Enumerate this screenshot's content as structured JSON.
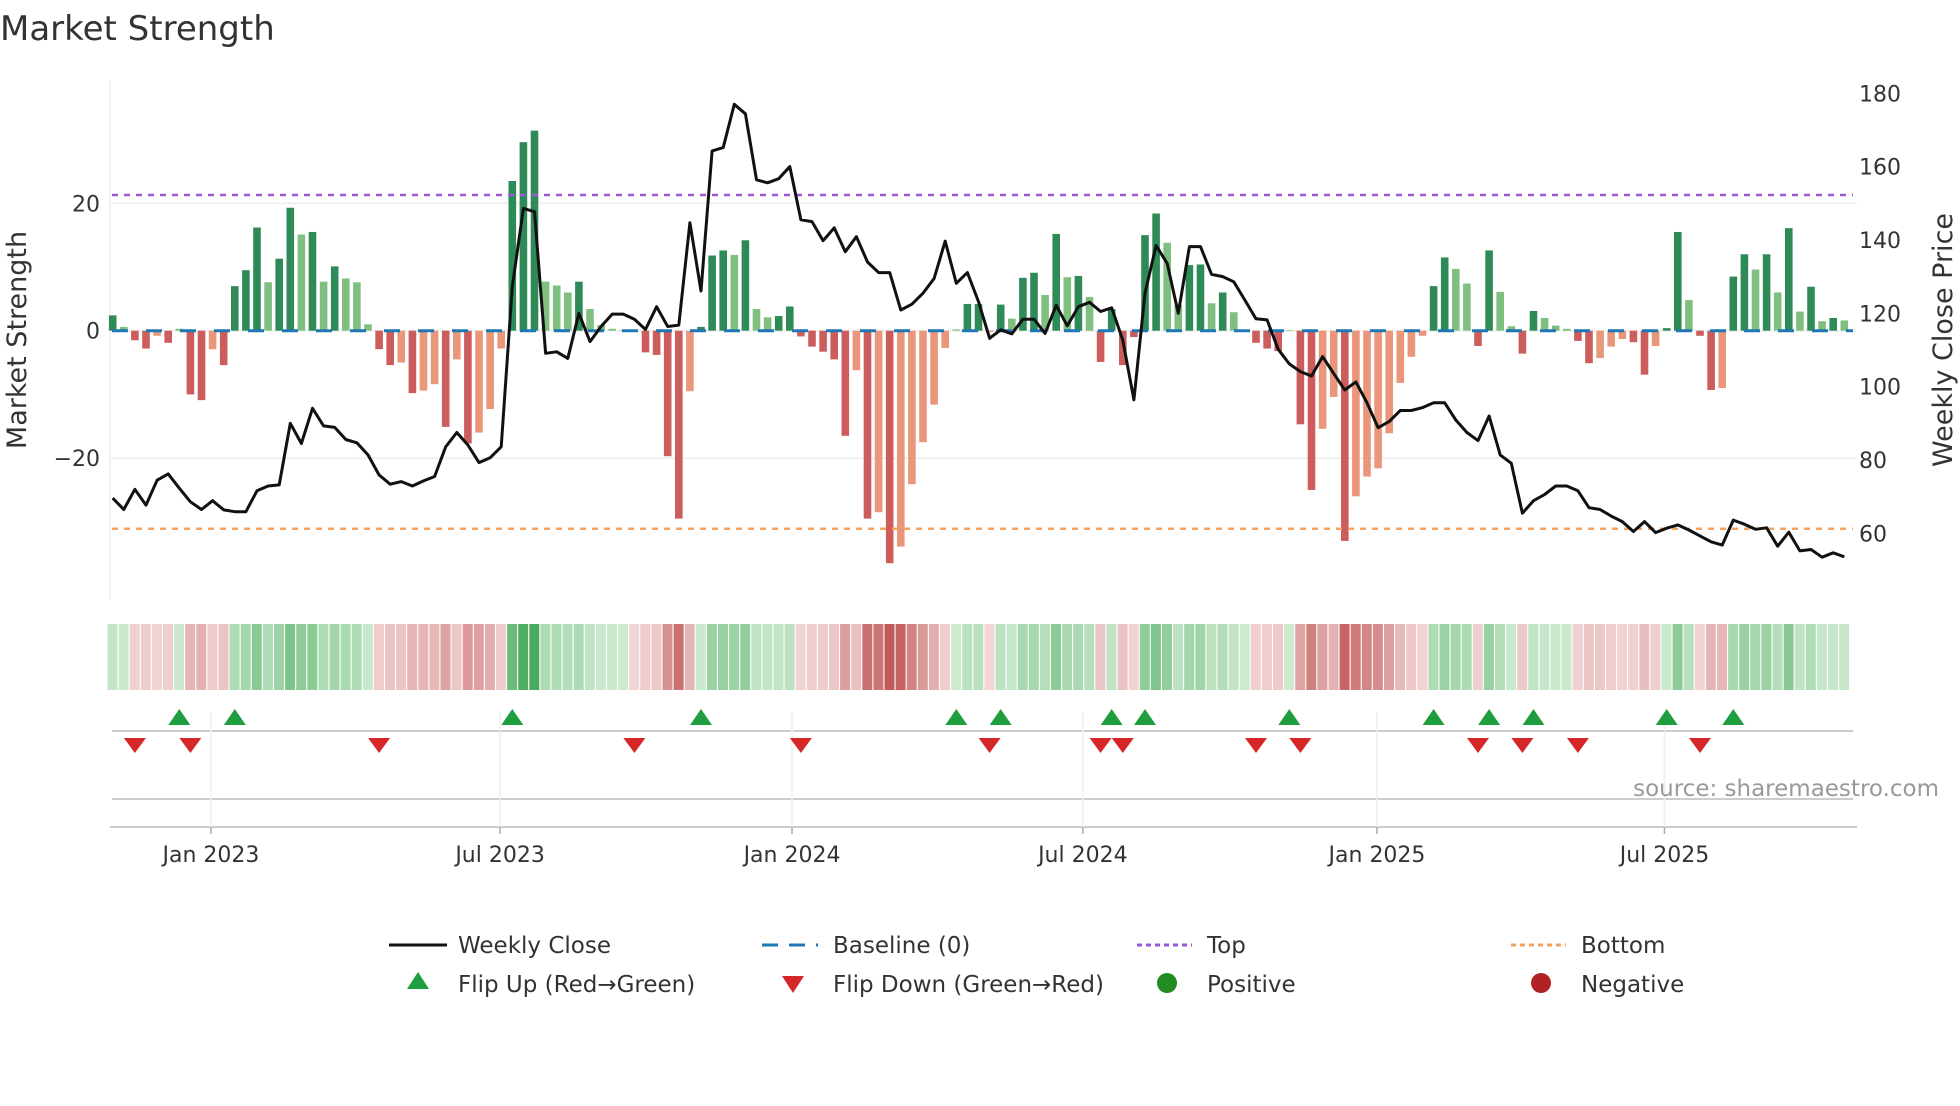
{
  "chart_data": {
    "type": "bar",
    "title": "Market Strength",
    "ylabel_left": "Market Strength",
    "ylabel_right": "Weekly Close Price",
    "source": "source: sharemaestro.com",
    "ylim_left": [
      -42.3,
      39.4
    ],
    "ylim_right": [
      41.8,
      183.6
    ],
    "left_ticks": [
      {
        "value": 20,
        "label": "20"
      },
      {
        "value": 0,
        "label": "0"
      },
      {
        "value": -20,
        "label": "−20"
      }
    ],
    "right_ticks": [
      {
        "value": 60,
        "label": "60"
      },
      {
        "value": 80,
        "label": "80"
      },
      {
        "value": 100,
        "label": "100"
      },
      {
        "value": 120,
        "label": "120"
      },
      {
        "value": 140,
        "label": "140"
      },
      {
        "value": 160,
        "label": "160"
      },
      {
        "value": 180,
        "label": "180"
      }
    ],
    "x_ticks": [
      {
        "label": "Jan 2023",
        "week": 8.85
      },
      {
        "label": "Jul 2023",
        "week": 34.9
      },
      {
        "label": "Jan 2024",
        "week": 61.2
      },
      {
        "label": "Jul 2024",
        "week": 87.4
      },
      {
        "label": "Jan 2025",
        "week": 113.9
      },
      {
        "label": "Jul 2025",
        "week": 139.8
      }
    ],
    "top_level": 21.3,
    "bottom_level": -31.1,
    "baseline": 0,
    "strength": [
      2.4,
      0.6,
      -1.5,
      -2.8,
      -0.8,
      -1.9,
      0.3,
      -10,
      -10.9,
      -2.9,
      -5.4,
      7.0,
      9.5,
      16.2,
      7.6,
      11.3,
      19.3,
      15.1,
      15.5,
      7.7,
      10.1,
      8.2,
      7.6,
      1.0,
      -2.9,
      -5.4,
      -5.0,
      -9.8,
      -9.4,
      -8.4,
      -15.1,
      -4.5,
      -17.7,
      -16,
      -12.3,
      -2.8,
      23.5,
      29.6,
      31.4,
      7.7,
      7.1,
      6.0,
      7.7,
      3.4,
      0.9,
      0.3,
      0.1,
      -0.2,
      -3.4,
      -3.8,
      -19.7,
      -29.5,
      -9.5,
      0.6,
      11.8,
      12.6,
      11.9,
      14.2,
      3.4,
      2.1,
      2.3,
      3.8,
      -0.9,
      -2.5,
      -3.3,
      -4.5,
      -16.5,
      -6.2,
      -29.5,
      -28.5,
      -36.5,
      -33.9,
      -24.1,
      -17.5,
      -11.6,
      -2.7,
      0.2,
      4.2,
      4.2,
      -0.2,
      4.1,
      1.9,
      8.3,
      9.1,
      5.6,
      15.2,
      8.4,
      8.6,
      5.3,
      -4.9,
      3.4,
      -5.4,
      -1.0,
      15.0,
      18.4,
      13.8,
      4.0,
      10.3,
      10.4,
      4.3,
      6.0,
      2.9,
      0.1,
      -1.9,
      -2.8,
      -3.2,
      0.1,
      -14.7,
      -25,
      -15.4,
      -10.4,
      -33,
      -26,
      -22.9,
      -21.6,
      -16.1,
      -8.2,
      -4.1,
      -0.8,
      7.0,
      11.5,
      9.7,
      7.4,
      -2.4,
      12.6,
      6.1,
      0.7,
      -3.6,
      3.1,
      2.0,
      0.8,
      0.3,
      -1.6,
      -5.1,
      -4.3,
      -2.5,
      -1.3,
      -1.8,
      -6.9,
      -2.4,
      0.4,
      15.5,
      4.8,
      -0.8,
      -9.3,
      -9.0,
      8.5,
      12.0,
      9.6,
      12.0,
      6.0,
      16.1,
      3.0,
      6.9,
      1.5,
      2.0,
      1.6
    ],
    "shade": "DLDDLDLDDLDDDDLDDLDLDLLLDDLDLLDLDLLLDDDLLLDLLLLLDDDDLDDDLDLLDDDDDDDLDLDLLLLLLDDLDLDDLDLDLDDDDDDLLDDLDLLDDDLDDLLDLLLLLLLDDLLDDLLDDLLLDDLLLDDLDDLDDLDDLDLDLDLDL",
    "weekly_close": [
      69.6,
      66.5,
      72,
      67.7,
      74.5,
      76.2,
      72.3,
      68.6,
      66.5,
      68.9,
      66.4,
      65.9,
      65.9,
      71.6,
      72.9,
      73.2,
      90,
      84.5,
      94.1,
      89.3,
      88.9,
      85.6,
      84.7,
      81.4,
      75.9,
      73.4,
      74.1,
      72.9,
      74.3,
      75.5,
      83.6,
      87.5,
      84.1,
      79.3,
      80.6,
      83.6,
      127.3,
      148.6,
      147.7,
      109.1,
      109.5,
      107.7,
      120,
      112.3,
      116.4,
      119.8,
      119.8,
      118.4,
      115.6,
      121.8,
      116.4,
      116.8,
      144.7,
      126.1,
      164.3,
      165.2,
      177,
      174.4,
      156.4,
      155.6,
      156.7,
      160,
      145.5,
      145,
      139.8,
      143.3,
      136.8,
      140.9,
      134,
      131.1,
      131.1,
      120.9,
      122.5,
      125.5,
      129.5,
      139.7,
      128.2,
      131.1,
      123.2,
      113.2,
      115.5,
      114.4,
      118.4,
      118.4,
      114.5,
      122.2,
      116.6,
      121.8,
      123,
      120.5,
      121.5,
      112.7,
      96.4,
      125.5,
      138.5,
      133.6,
      120,
      138.2,
      138.2,
      130.6,
      130,
      128.6,
      123.6,
      118.5,
      118.2,
      110.2,
      106.2,
      104.1,
      102.9,
      108.2,
      103.6,
      99.1,
      101.3,
      95.6,
      88.8,
      90.5,
      93.5,
      93.5,
      94.3,
      95.6,
      95.6,
      90.9,
      87.5,
      85.3,
      92,
      81.4,
      79.1,
      65.5,
      68.9,
      70.6,
      72.9,
      72.9,
      71.6,
      67,
      66.5,
      64.7,
      63.2,
      60.5,
      63.2,
      60.2,
      61.4,
      62.3,
      60.9,
      59.3,
      57.7,
      56.8,
      63.6,
      62.5,
      61.1,
      61.5,
      56.5,
      60.3,
      55.2,
      55.6,
      53.5,
      54.7,
      53.6
    ],
    "flip_up_weeks": [
      6,
      11,
      36,
      53,
      76,
      80,
      90,
      93,
      106,
      119,
      124,
      128,
      140,
      146
    ],
    "flip_down_weeks": [
      2,
      7,
      24,
      47,
      62,
      79,
      89,
      91,
      103,
      107,
      123,
      127,
      132,
      143
    ],
    "legend": {
      "weekly_close": "Weekly Close",
      "baseline": "Baseline (0)",
      "top": "Top",
      "bottom": "Bottom",
      "flip_up": "Flip Up (Red→Green)",
      "flip_down": "Flip Down (Green→Red)",
      "positive": "Positive",
      "negative": "Negative"
    },
    "colors": {
      "pos_strong": "#2e8b57",
      "pos_weak": "#7fbf7f",
      "neg_strong": "#cd5c5c",
      "neg_weak": "#e9967a",
      "line": "#111111",
      "baseline": "#1f77b4",
      "top": "#9b59d6",
      "bottom": "#f4a460",
      "flip_up": "#1e9e3e",
      "flip_down": "#d62728",
      "positive": "#228b22",
      "negative": "#b22222"
    }
  }
}
